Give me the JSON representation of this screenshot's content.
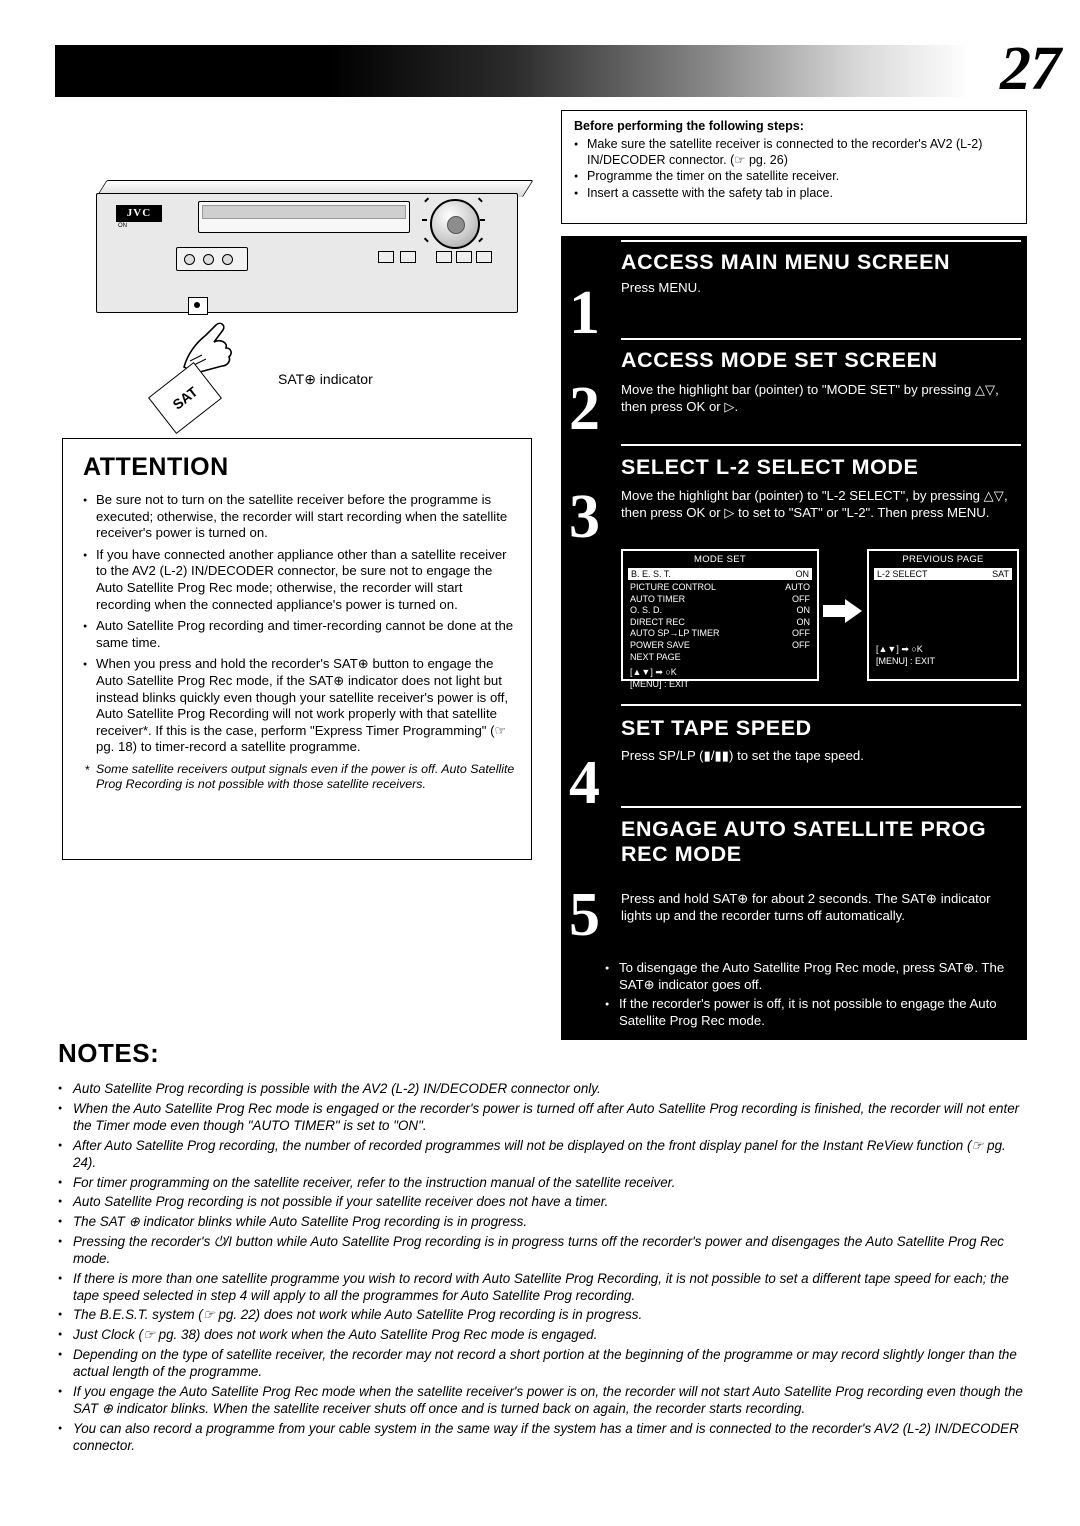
{
  "page_number": "27",
  "note_box": {
    "title": "Before performing the following steps:",
    "items": [
      "Make sure the satellite receiver is connected to the recorder's AV2 (L-2) IN/DECODER connector. (☞ pg. 26)",
      "Programme the timer on the satellite receiver.",
      "Insert a cassette with the safety tab in place."
    ]
  },
  "illustration": {
    "brand": "JVC",
    "brand_sub": "ON",
    "sat_badge": "SAT",
    "sat_indicator_label": "SAT⊕ indicator"
  },
  "attention": {
    "title": "ATTENTION",
    "items": [
      "Be sure not to turn on the satellite receiver before the programme is executed; otherwise, the recorder will start recording when the satellite receiver's power is turned on.",
      "If you have connected another appliance other than a satellite receiver to the AV2 (L-2) IN/DECODER connector, be sure not to engage the Auto Satellite Prog Rec mode; otherwise, the recorder will start recording when the connected appliance's power is turned on.",
      "Auto Satellite Prog recording and timer-recording cannot be done at the same time.",
      "When you press and hold the recorder's SAT⊕ button to engage the Auto Satellite Prog Rec mode, if the SAT⊕ indicator does not light but instead blinks quickly even though your satellite receiver's power is off, Auto Satellite Prog Recording will not work properly with that satellite receiver*. If this is the case, perform \"Express Timer Programming\" (☞ pg. 18) to timer-record a satellite programme."
    ],
    "footnote": "Some satellite receivers output signals even if the power is off. Auto Satellite Prog Recording is not possible with those satellite receivers."
  },
  "steps": [
    {
      "number": "1",
      "title": "ACCESS MAIN MENU SCREEN",
      "body": "Press MENU."
    },
    {
      "number": "2",
      "title": "ACCESS MODE SET SCREEN",
      "body": "Move the highlight bar (pointer) to \"MODE SET\" by pressing △▽, then press OK or ▷."
    },
    {
      "number": "3",
      "title": "SELECT L-2 SELECT MODE",
      "body": "Move the highlight bar (pointer) to \"L-2 SELECT\", by pressing △▽, then press OK or ▷ to set to \"SAT\" or \"L-2\". Then press MENU."
    },
    {
      "number": "4",
      "title": "SET TAPE SPEED",
      "body": "Press SP/LP (▮/▮▮) to set the tape speed."
    },
    {
      "number": "5",
      "title": "ENGAGE AUTO SATELLITE PROG REC MODE",
      "body": "Press and hold SAT⊕ for about 2 seconds. The SAT⊕ indicator lights up and the recorder turns off automatically."
    }
  ],
  "osd_left": {
    "caption": "MODE SET",
    "highlight": {
      "label": "B. E. S. T.",
      "value": "ON"
    },
    "rows": [
      {
        "label": "PICTURE CONTROL",
        "value": "AUTO"
      },
      {
        "label": "AUTO TIMER",
        "value": "OFF"
      },
      {
        "label": "O. S. D.",
        "value": "ON"
      },
      {
        "label": "DIRECT REC",
        "value": "ON"
      },
      {
        "label": "AUTO SP→LP TIMER",
        "value": "OFF"
      },
      {
        "label": "POWER SAVE",
        "value": "OFF"
      },
      {
        "label": "NEXT PAGE",
        "value": ""
      }
    ],
    "footer1": "[▲▼] ➡ ○K",
    "footer2": "[MENU] : EXIT"
  },
  "osd_right": {
    "caption": "PREVIOUS PAGE",
    "highlight": {
      "label": "L-2 SELECT",
      "value": "SAT"
    },
    "footer1": "[▲▼] ➡ ○K",
    "footer2": "[MENU] : EXIT"
  },
  "step5_bullets": [
    "To disengage the Auto Satellite Prog Rec mode, press SAT⊕. The SAT⊕ indicator goes off.",
    "If the recorder's power is off, it is not possible to engage the Auto Satellite Prog Rec mode."
  ],
  "notes": {
    "title": "NOTES:",
    "items": [
      "Auto Satellite Prog recording is possible with the AV2 (L-2) IN/DECODER connector only.",
      "When the Auto Satellite Prog Rec mode is engaged or the recorder's power is turned off after Auto Satellite Prog recording is finished, the recorder will not enter the Timer mode even though \"AUTO TIMER\" is set to \"ON\".",
      "After Auto Satellite Prog recording, the number of recorded programmes will not be displayed on the front display panel for the Instant ReView function (☞ pg. 24).",
      "For timer programming on the satellite receiver, refer to the instruction manual of the satellite receiver.",
      "Auto Satellite Prog recording is not possible if your satellite receiver does not have a timer.",
      "The SAT ⊕ indicator blinks while Auto Satellite Prog recording is in progress.",
      "Pressing the recorder's ⏻/I button while Auto Satellite Prog recording is in progress turns off the recorder's power and disengages the Auto Satellite Prog Rec mode.",
      "If there is more than one satellite programme you wish to record with Auto Satellite Prog Recording, it is not possible to set a different tape speed for each; the tape speed selected in step 4 will apply to all the programmes for Auto Satellite Prog recording.",
      "The B.E.S.T. system (☞ pg. 22) does not work while Auto Satellite Prog recording is in progress.",
      "Just Clock (☞ pg. 38) does not work when the Auto Satellite Prog Rec mode is engaged.",
      "Depending on the type of satellite receiver, the recorder may not record a short portion at the beginning of the programme or may record slightly longer than the actual length of the programme.",
      "If you engage the Auto Satellite Prog Rec mode when the satellite receiver's power is on, the recorder will not start Auto Satellite Prog recording even though the SAT ⊕ indicator blinks. When the satellite receiver shuts off once and is turned back on again, the recorder starts recording.",
      "You can also record a programme from your cable system in the same way if the system has a timer and is connected to the recorder's AV2 (L-2) IN/DECODER connector."
    ]
  }
}
